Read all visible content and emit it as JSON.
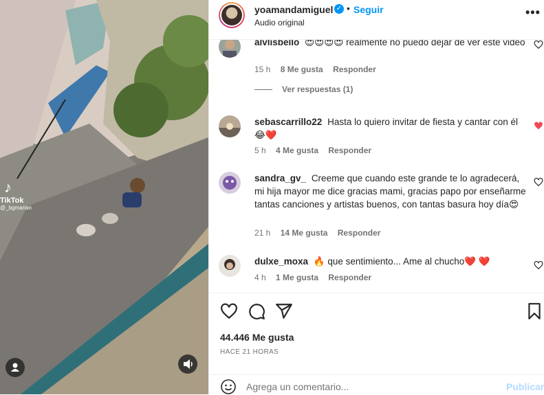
{
  "header": {
    "username": "yoamandamiguel",
    "separator": "•",
    "follow_label": "Seguir",
    "audio_label": "Audio original",
    "more_label": "•••"
  },
  "media": {
    "watermark_name": "TikTok",
    "watermark_handle": "@_bgmarian"
  },
  "comments": [
    {
      "user": "alvlisbello",
      "text": "😍😍😍😍 realmente no puedo dejar de ver este video",
      "time": "15 h",
      "likes": "8 Me gusta",
      "reply": "Responder",
      "view_replies": "Ver respuestas (1)",
      "liked": false
    },
    {
      "user": "sebascarrillo22",
      "text": "Hasta lo quiero invitar de fiesta y cantar con él 😂❤️",
      "time": "5 h",
      "likes": "4 Me gusta",
      "reply": "Responder",
      "liked": true
    },
    {
      "user": "sandra_gv_",
      "text": "Creeme que cuando este grande te lo agradecerá, mi hija mayor me dice gracias mami, gracias papo por enseñarme tantas canciones y artistas buenos, con tantas basura hoy día😍",
      "time": "21 h",
      "likes": "14 Me gusta",
      "reply": "Responder",
      "liked": false
    },
    {
      "user": "dulxe_moxa",
      "text": "🔥 que sentimiento... Ame al chucho❤️ ❤️",
      "time": "4 h",
      "likes": "1 Me gusta",
      "reply": "Responder",
      "liked": false
    }
  ],
  "likes_count": "44.446 Me gusta",
  "time_ago": "HACE 21 HORAS",
  "add_comment": {
    "placeholder": "Agrega un comentario...",
    "publish_label": "Publicar"
  },
  "colors": {
    "accent": "#0095f6",
    "like_red": "#ed4956",
    "muted": "#737373",
    "publish_disabled": "#b3dbff"
  }
}
